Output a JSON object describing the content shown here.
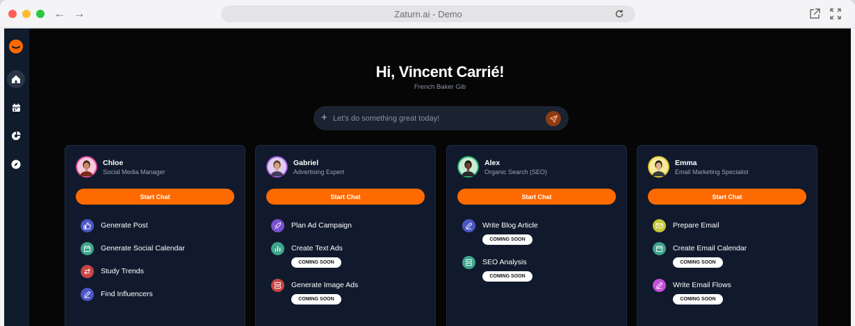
{
  "browser": {
    "url_title": "Zaturn.ai - Demo",
    "traffic_colors": [
      "#ff5f57",
      "#febc2e",
      "#28c840"
    ]
  },
  "sidebar": {
    "items": [
      {
        "icon": "logo-icon"
      },
      {
        "icon": "home-icon",
        "active": true
      },
      {
        "icon": "calendar-icon"
      },
      {
        "icon": "chart-icon"
      },
      {
        "icon": "compass-icon"
      }
    ]
  },
  "header": {
    "greeting": "Hi, Vincent Carrié!",
    "business": "French Baker Gib"
  },
  "prompt": {
    "placeholder": "Let's do something great today!"
  },
  "colors": {
    "accent": "#ff6a00",
    "card_bg": "#111a2d",
    "page_bg": "#060606"
  },
  "agents": [
    {
      "name": "Chloe",
      "role": "Social Media Manager",
      "start_label": "Start Chat",
      "tasks": [
        {
          "label": "Generate Post",
          "icon": "thumbs-up-icon",
          "color": "#4b56c8",
          "badge": ""
        },
        {
          "label": "Generate Social Calendar",
          "icon": "calendar-icon",
          "color": "#3ea58c",
          "badge": ""
        },
        {
          "label": "Study Trends",
          "icon": "swap-icon",
          "color": "#c94444",
          "badge": ""
        },
        {
          "label": "Find Influencers",
          "icon": "pen-icon",
          "color": "#4b56c8",
          "badge": ""
        }
      ]
    },
    {
      "name": "Gabriel",
      "role": "Advertising Expert",
      "start_label": "Start Chat",
      "tasks": [
        {
          "label": "Plan Ad Campaign",
          "icon": "rocket-icon",
          "color": "#7a52d0",
          "badge": ""
        },
        {
          "label": "Create Text Ads",
          "icon": "bar-chart-icon",
          "color": "#3ea58c",
          "badge": "COMING SOON"
        },
        {
          "label": "Generate Image Ads",
          "icon": "layout-icon",
          "color": "#c94444",
          "badge": "COMING SOON"
        }
      ]
    },
    {
      "name": "Alex",
      "role": "Organic Search (SEO)",
      "start_label": "Start Chat",
      "tasks": [
        {
          "label": "Write Blog Article",
          "icon": "pen-icon",
          "color": "#4b56c8",
          "badge": "COMING SOON"
        },
        {
          "label": "SEO Analysis",
          "icon": "layout-icon",
          "color": "#3ea58c",
          "badge": "COMING SOON"
        }
      ]
    },
    {
      "name": "Emma",
      "role": "Email Marketing Specialist",
      "start_label": "Start Chat",
      "tasks": [
        {
          "label": "Prepare Email",
          "icon": "mail-icon",
          "color": "#c8c83a",
          "badge": ""
        },
        {
          "label": "Create Email Calendar",
          "icon": "calendar-icon",
          "color": "#3ea58c",
          "badge": "COMING SOON"
        },
        {
          "label": "Write Email Flows",
          "icon": "pen-icon",
          "color": "#c64fd8",
          "badge": "COMING SOON"
        }
      ]
    }
  ]
}
